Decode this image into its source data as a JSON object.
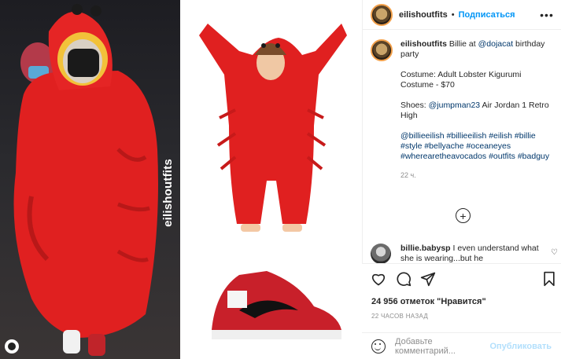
{
  "photo": {
    "watermark": "eilishoutfits"
  },
  "header": {
    "username": "eilishoutfits",
    "separator": "•",
    "follow_label": "Подписаться",
    "more_icon": "more-horizontal-icon"
  },
  "caption": {
    "username": "eilishoutfits",
    "line1_prefix": "Billie at ",
    "line1_mention": "@dojacat",
    "line1_suffix": " birthday party",
    "costume": "Costume: Adult Lobster Kigurumi Costume - $70",
    "shoes_prefix": "Shoes: ",
    "shoes_mention": "@jumpman23",
    "shoes_suffix": " Air Jordan 1 Retro High",
    "hashtags": "@billieeilish #billieeilish #eilish #billie #style #bellyache #oceaneyes #wherearetheavocados #outfits #badguy",
    "time": "22 ч."
  },
  "load_more_icon": "plus-circle-icon",
  "comment": {
    "username": "billie.babysp",
    "text": " I even understand what she is wearing...but he"
  },
  "actions": {
    "likes": "24 956 отметок \"Нравится\"",
    "date": "22 ЧАСОВ НАЗАД",
    "comment_placeholder": "Добавьте комментарий...",
    "post_label": "Опубликовать"
  },
  "colors": {
    "accent": "#0095f6",
    "costume_red": "#e32222"
  }
}
